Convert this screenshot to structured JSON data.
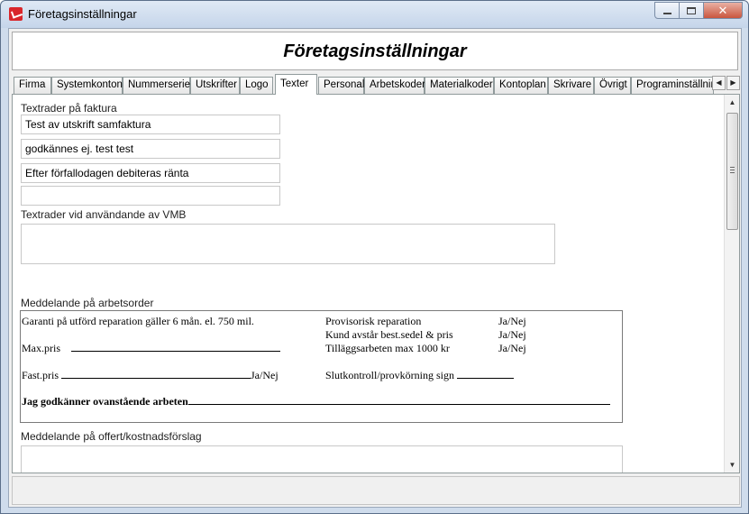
{
  "window": {
    "title": "Företagsinställningar",
    "icon": "app-icon",
    "buttons": {
      "minimize": "minimize-icon",
      "maximize": "maximize-icon",
      "close": "✕"
    }
  },
  "header": {
    "title": "Företagsinställningar"
  },
  "tabs": [
    {
      "label": "Firma",
      "active": false
    },
    {
      "label": "Systemkonton",
      "active": false
    },
    {
      "label": "Nummerserier",
      "active": false
    },
    {
      "label": "Utskrifter",
      "active": false
    },
    {
      "label": "Logo",
      "active": false
    },
    {
      "label": "Texter",
      "active": true
    },
    {
      "label": "Personal",
      "active": false
    },
    {
      "label": "Arbetskoder",
      "active": false
    },
    {
      "label": "Materialkoder",
      "active": false
    },
    {
      "label": "Kontoplan",
      "active": false
    },
    {
      "label": "Skrivare",
      "active": false
    },
    {
      "label": "Övrigt",
      "active": false
    },
    {
      "label": "Programinställning",
      "active": false
    }
  ],
  "tab_scroll": {
    "left": "◀",
    "right": "▶"
  },
  "texter": {
    "faktura_label": "Textrader på faktura",
    "faktura_rows": [
      "Test av utskrift samfaktura",
      "godkännes ej. test test",
      "Efter förfallodagen debiteras ränta",
      ""
    ],
    "vmb_label": "Textrader vid användande av VMB",
    "vmb_value": "",
    "arbetsorder_label": "Meddelande på arbetsorder",
    "arbetsorder": {
      "garanti": "Garanti på utförd reparation gäller 6 mån. el. 750 mil.",
      "maxpris": "Max.pris",
      "fastpris": "Fast.pris",
      "fastpris_janej": "Ja/Nej",
      "godkanner": "Jag godkänner ovanstående arbeten",
      "provisorisk": "Provisorisk reparation",
      "kund": "Kund avstår best.sedel & pris",
      "tillagg": "Tilläggsarbeten max 1000 kr",
      "slutkontroll": "Slutkontroll/provkörning sign",
      "janej1": "Ja/Nej",
      "janej2": "Ja/Nej",
      "janej3": "Ja/Nej"
    },
    "offert_label": "Meddelande på offert/kostnadsförslag",
    "offert_value": ""
  },
  "scrollbar": {
    "up": "▲",
    "down": "▼"
  }
}
